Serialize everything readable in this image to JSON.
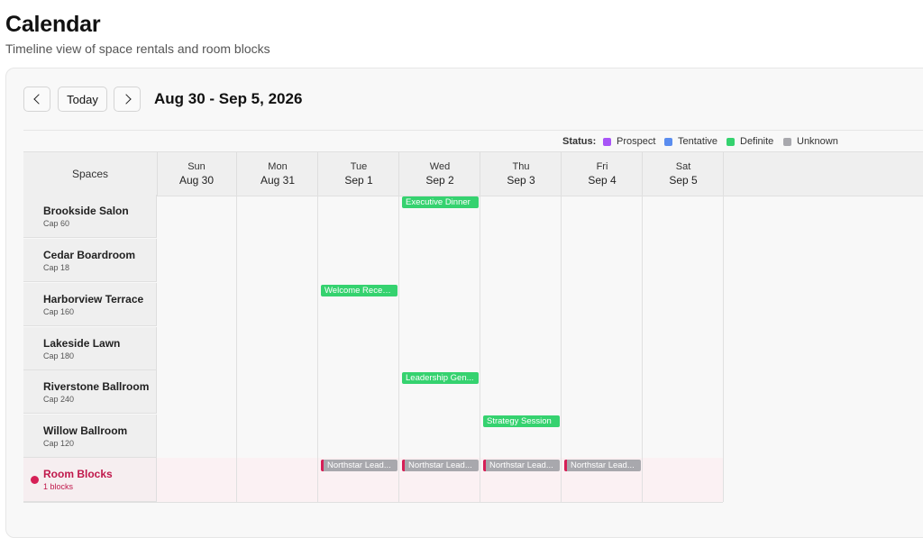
{
  "header": {
    "title": "Calendar",
    "subtitle": "Timeline view of space rentals and room blocks"
  },
  "toolbar": {
    "prev_icon": "chevron-left-icon",
    "today_label": "Today",
    "next_icon": "chevron-right-icon",
    "range_title": "Aug 30 - Sep 5, 2026"
  },
  "legend": {
    "label": "Status:",
    "items": [
      {
        "label": "Prospect",
        "color": "#a855f7"
      },
      {
        "label": "Tentative",
        "color": "#5b8def"
      },
      {
        "label": "Definite",
        "color": "#35d26f"
      },
      {
        "label": "Unknown",
        "color": "#a8a8ad"
      }
    ]
  },
  "grid": {
    "spaces_header": "Spaces",
    "days": [
      {
        "dow": "Sun",
        "date": "Aug 30"
      },
      {
        "dow": "Mon",
        "date": "Aug 31"
      },
      {
        "dow": "Tue",
        "date": "Sep 1"
      },
      {
        "dow": "Wed",
        "date": "Sep 2"
      },
      {
        "dow": "Thu",
        "date": "Sep 3"
      },
      {
        "dow": "Fri",
        "date": "Sep 4"
      },
      {
        "dow": "Sat",
        "date": "Sep 5"
      }
    ],
    "spaces": [
      {
        "name": "Brookside Salon",
        "cap": "Cap 60"
      },
      {
        "name": "Cedar Boardroom",
        "cap": "Cap 18"
      },
      {
        "name": "Harborview Terrace",
        "cap": "Cap 160"
      },
      {
        "name": "Lakeside Lawn",
        "cap": "Cap 180"
      },
      {
        "name": "Riverstone Ballroom",
        "cap": "Cap 240"
      },
      {
        "name": "Willow Ballroom",
        "cap": "Cap 120"
      }
    ],
    "room_blocks": {
      "title": "Room Blocks",
      "sub": "1 blocks"
    },
    "events": [
      {
        "label": "Executive Dinner",
        "status": "Definite",
        "space": "Brookside Salon",
        "day": "Wed"
      },
      {
        "label": "Welcome Recep...",
        "status": "Definite",
        "space": "Harborview Terrace",
        "day": "Tue"
      },
      {
        "label": "Leadership Gen...",
        "status": "Definite",
        "space": "Riverstone Ballroom",
        "day": "Wed"
      },
      {
        "label": "Strategy Session",
        "status": "Definite",
        "space": "Willow Ballroom",
        "day": "Thu"
      }
    ],
    "block_events": [
      {
        "label": "Northstar Lead...",
        "status": "Unknown",
        "day": "Tue"
      },
      {
        "label": "Northstar Lead...",
        "status": "Unknown",
        "day": "Wed"
      },
      {
        "label": "Northstar Lead...",
        "status": "Unknown",
        "day": "Thu"
      },
      {
        "label": "Northstar Lead...",
        "status": "Unknown",
        "day": "Fri"
      }
    ]
  }
}
